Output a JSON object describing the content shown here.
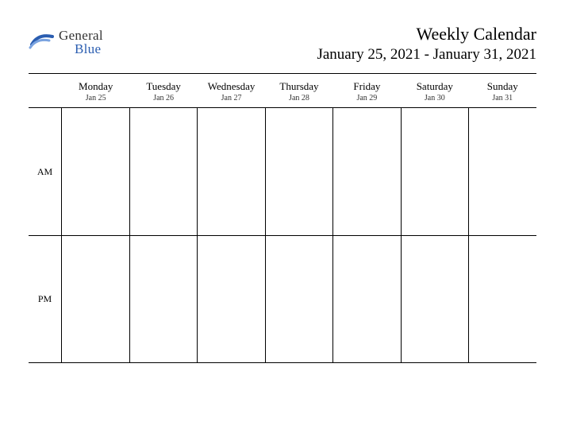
{
  "logo": {
    "line1": "General",
    "line2": "Blue"
  },
  "header": {
    "title": "Weekly Calendar",
    "subtitle": "January 25, 2021 - January 31, 2021"
  },
  "days": [
    {
      "name": "Monday",
      "date": "Jan 25"
    },
    {
      "name": "Tuesday",
      "date": "Jan 26"
    },
    {
      "name": "Wednesday",
      "date": "Jan 27"
    },
    {
      "name": "Thursday",
      "date": "Jan 28"
    },
    {
      "name": "Friday",
      "date": "Jan 29"
    },
    {
      "name": "Saturday",
      "date": "Jan 30"
    },
    {
      "name": "Sunday",
      "date": "Jan 31"
    }
  ],
  "periods": [
    "AM",
    "PM"
  ]
}
